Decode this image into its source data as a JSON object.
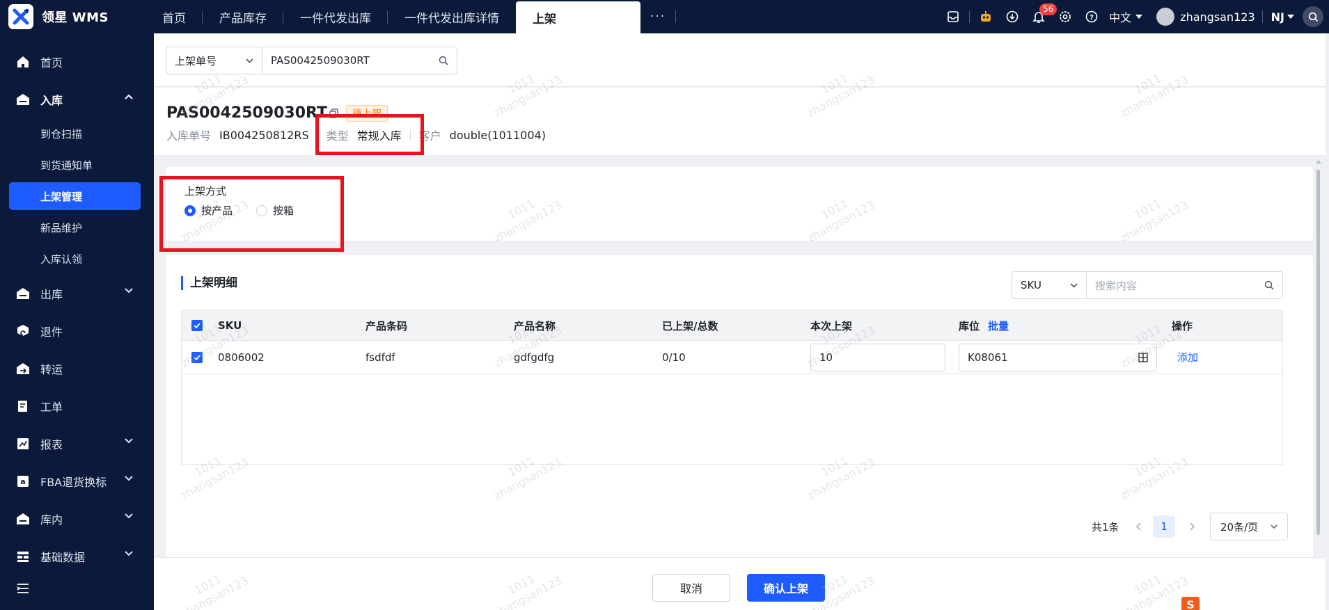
{
  "brand": {
    "name": "领星 WMS"
  },
  "tabs": [
    {
      "label": "首页"
    },
    {
      "label": "产品库存"
    },
    {
      "label": "一件代发出库"
    },
    {
      "label": "一件代发出库详情"
    },
    {
      "label": "上架"
    }
  ],
  "topbar": {
    "more": "···",
    "notification_count": "56",
    "language": "中文",
    "username": "zhangsan123",
    "warehouse": "NJ"
  },
  "sidebar": {
    "items": [
      {
        "label": "首页"
      },
      {
        "label": "入库"
      },
      {
        "label": "出库"
      },
      {
        "label": "退件"
      },
      {
        "label": "转运"
      },
      {
        "label": "工单"
      },
      {
        "label": "报表"
      },
      {
        "label": "FBA退货换标"
      },
      {
        "label": "库内"
      },
      {
        "label": "基础数据"
      }
    ],
    "subitems": [
      {
        "label": "到仓扫描"
      },
      {
        "label": "到货通知单"
      },
      {
        "label": "上架管理"
      },
      {
        "label": "新品维护"
      },
      {
        "label": "入库认领"
      }
    ]
  },
  "search": {
    "field": "上架单号",
    "value": "PAS0042509030RT"
  },
  "detail": {
    "order_no": "PAS0042509030RT",
    "status": "待上架",
    "inbound_label": "入库单号",
    "inbound_no": "IB004250812RS",
    "type_label": "类型",
    "type_value": "常规入库",
    "customer_label": "客户",
    "customer_value": "double(1011004)"
  },
  "putaway_method": {
    "label": "上架方式",
    "options": [
      {
        "label": "按产品",
        "selected": true
      },
      {
        "label": "按箱",
        "selected": false
      }
    ]
  },
  "table_section": {
    "title": "上架明细",
    "filter_field": "SKU",
    "filter_placeholder": "搜索内容",
    "columns": [
      "SKU",
      "产品条码",
      "产品名称",
      "已上架/总数",
      "本次上架",
      "库位",
      "操作"
    ],
    "batch_label": "批量",
    "rows": [
      {
        "sku": "0806002",
        "barcode": "fsdfdf",
        "name": "gdfgdfg",
        "progress": "0/10",
        "qty": "10",
        "location": "K08061",
        "action": "添加"
      }
    ]
  },
  "pagination": {
    "total": "共1条",
    "page": "1",
    "size": "20条/页"
  },
  "footer": {
    "cancel": "取消",
    "confirm": "确认上架"
  },
  "watermark": {
    "line1": "1011",
    "line2": "zhangsan123"
  },
  "colors": {
    "nav_bg": "#0b1a3a",
    "accent": "#1f5cff",
    "highlight": "#e8131f",
    "status": "#ff7d00"
  }
}
